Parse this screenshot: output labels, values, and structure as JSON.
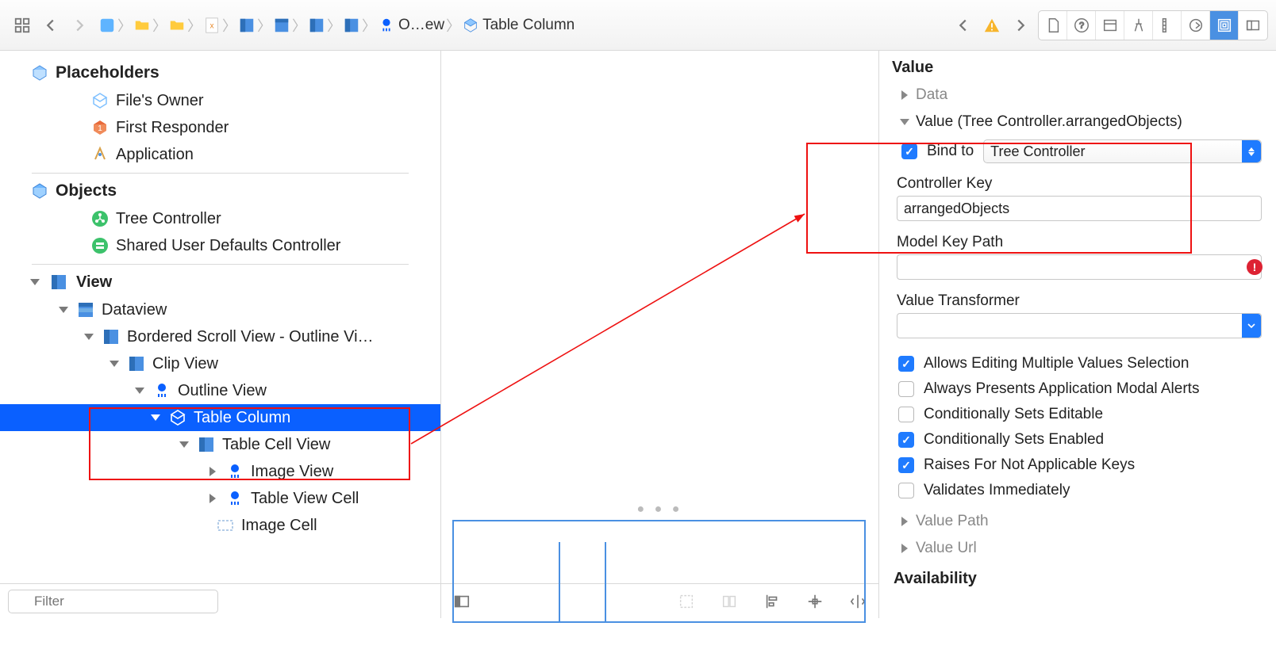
{
  "toolbar": {
    "bc_item_ow": "O…ew",
    "bc_item_tc": "Table Column"
  },
  "outline": {
    "placeholders_label": "Placeholders",
    "files_owner": "File's Owner",
    "first_responder": "First Responder",
    "application": "Application",
    "objects_label": "Objects",
    "tree_controller": "Tree Controller",
    "shared_defaults": "Shared User Defaults Controller",
    "view_label": "View",
    "dataview": "Dataview",
    "bordered_scroll": "Bordered Scroll View - Outline Vi…",
    "clip_view": "Clip View",
    "outline_view": "Outline View",
    "table_column": "Table Column",
    "table_cell_view": "Table Cell View",
    "image_view": "Image View",
    "table_view_cell": "Table View Cell",
    "image_cell": "Image Cell",
    "filter_placeholder": "Filter"
  },
  "inspector": {
    "value_header": "Value",
    "data_label": "Data",
    "value_binding_label": "Value (Tree Controller.arrangedObjects)",
    "bind_to_label": "Bind to",
    "bind_to_value": "Tree Controller",
    "controller_key_label": "Controller Key",
    "controller_key_value": "arrangedObjects",
    "model_key_path_label": "Model Key Path",
    "model_key_path_value": "",
    "value_transformer_label": "Value Transformer",
    "value_transformer_value": "",
    "allows_editing": "Allows Editing Multiple Values Selection",
    "always_presents": "Always Presents Application Modal Alerts",
    "cond_sets_editable": "Conditionally Sets Editable",
    "cond_sets_enabled": "Conditionally Sets Enabled",
    "raises_na": "Raises For Not Applicable Keys",
    "validates_immediately": "Validates Immediately",
    "value_path": "Value Path",
    "value_url": "Value Url",
    "availability": "Availability"
  }
}
